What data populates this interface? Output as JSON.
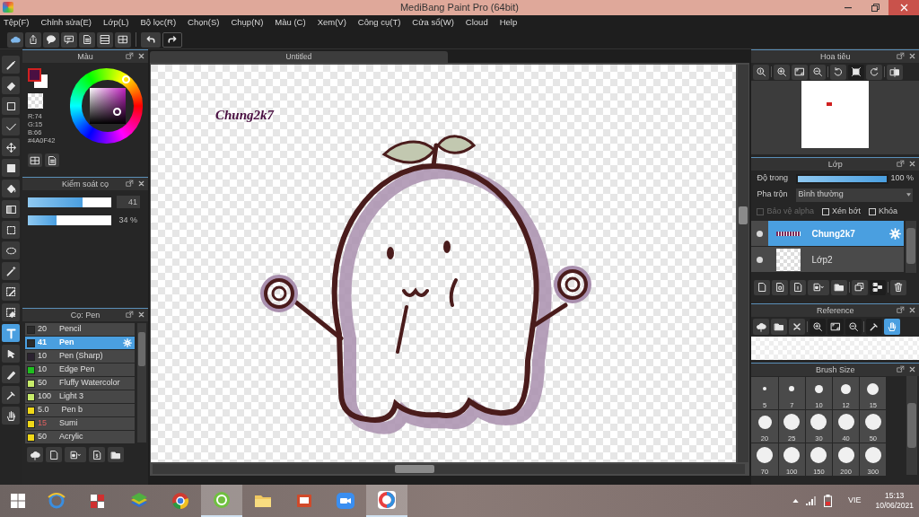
{
  "window": {
    "title": "MediBang Paint Pro (64bit)"
  },
  "menu": [
    "Tệp(F)",
    "Chỉnh sửa(E)",
    "Lớp(L)",
    "Bộ lọc(R)",
    "Chọn(S)",
    "Chụp(N)",
    "Màu (C)",
    "Xem(V)",
    "Công cụ(T)",
    "Cửa sổ(W)",
    "Cloud",
    "Help"
  ],
  "tools": [
    {
      "kind": "brush",
      "selected": false
    },
    {
      "kind": "eraser",
      "selected": false
    },
    {
      "kind": "square",
      "selected": false
    },
    {
      "kind": "polyline",
      "selected": false
    },
    {
      "kind": "move",
      "selected": false
    },
    {
      "kind": "fill",
      "selected": false
    },
    {
      "kind": "bucket",
      "selected": false
    },
    {
      "kind": "gradient",
      "selected": false
    },
    {
      "kind": "dashed",
      "selected": false
    },
    {
      "kind": "lasso",
      "selected": false
    },
    {
      "kind": "wand",
      "selected": false
    },
    {
      "kind": "selpen",
      "selected": false
    },
    {
      "kind": "seleraser",
      "selected": false
    },
    {
      "kind": "text",
      "selected": true
    },
    {
      "kind": "pointer",
      "selected": false
    },
    {
      "kind": "nib",
      "selected": false
    },
    {
      "kind": "dropper",
      "selected": false
    },
    {
      "kind": "hand",
      "selected": false
    }
  ],
  "color_panel": {
    "title": "Màu",
    "readouts": [
      "R:74",
      "G:15",
      "B:66"
    ],
    "hex": "#4A0F42"
  },
  "brush_control": {
    "title": "Kiểm soát cọ",
    "sliders": [
      {
        "level": 0.66,
        "reading": "41"
      },
      {
        "level": 0.34,
        "reading": "34 %"
      }
    ]
  },
  "brush_panel": {
    "title": "Cọ: Pen",
    "items": [
      {
        "size": "20",
        "name": "Pencil",
        "color": "#2b2b2b",
        "alert": false,
        "selected": false
      },
      {
        "size": "41",
        "name": "Pen",
        "color": "#2b2b2b",
        "alert": false,
        "selected": true
      },
      {
        "size": "10",
        "name": "Pen (Sharp)",
        "color": "#2b2230",
        "alert": false,
        "selected": false
      },
      {
        "size": "10",
        "name": "Edge Pen",
        "color": "#1fbf1f",
        "alert": false,
        "selected": false
      },
      {
        "size": "50",
        "name": "Fluffy Watercolor",
        "color": "#c8ec6a",
        "alert": false,
        "selected": false
      },
      {
        "size": "100",
        "name": "Light 3",
        "color": "#c8ec6a",
        "alert": false,
        "selected": false
      },
      {
        "size": "5.0",
        "name": " Pen b",
        "color": "#f0d818",
        "alert": false,
        "selected": false
      },
      {
        "size": "15",
        "name": "Sumi",
        "color": "#f0d818",
        "alert": true,
        "selected": false
      },
      {
        "size": "50",
        "name": "Acrylic",
        "color": "#f0d818",
        "alert": false,
        "selected": false
      }
    ]
  },
  "canvas": {
    "tab": "Untitled",
    "text": "Chung2k7"
  },
  "navigator": {
    "title": "Hoa tiêu"
  },
  "layers": {
    "title": "Lớp",
    "opacity_label": "Độ trong",
    "opacity": {
      "level": 1,
      "reading": "100 %"
    },
    "blend_label": "Pha trộn",
    "blend": "Bình thường",
    "options": [
      {
        "label": "Bảo vệ alpha",
        "checked": false,
        "disabled": true
      },
      {
        "label": "Xén bớt",
        "checked": false,
        "disabled": false
      },
      {
        "label": "Khóa",
        "checked": false,
        "disabled": false
      }
    ],
    "items": [
      {
        "name": "Chung2k7",
        "selected": true
      },
      {
        "name": "Lớp2",
        "selected": false
      }
    ]
  },
  "reference": {
    "title": "Reference"
  },
  "brush_size": {
    "title": "Brush Size",
    "sizes": [
      "5",
      "7",
      "10",
      "12",
      "15",
      "20",
      "25",
      "30",
      "40",
      "50",
      "70",
      "100",
      "150",
      "200",
      "300"
    ]
  },
  "taskbar": {
    "apps": [
      {
        "kind": "browser",
        "selected": false
      },
      {
        "kind": "tiles",
        "selected": false
      },
      {
        "kind": "stack",
        "selected": false
      },
      {
        "kind": "chrome",
        "selected": false
      },
      {
        "kind": "green",
        "selected": true
      },
      {
        "kind": "folder",
        "selected": false
      },
      {
        "kind": "slides",
        "selected": false
      },
      {
        "kind": "camera",
        "selected": false
      },
      {
        "kind": "medibang",
        "selected": true
      }
    ],
    "language": "VIE",
    "time": "15:13",
    "date": "10/06/2021"
  }
}
